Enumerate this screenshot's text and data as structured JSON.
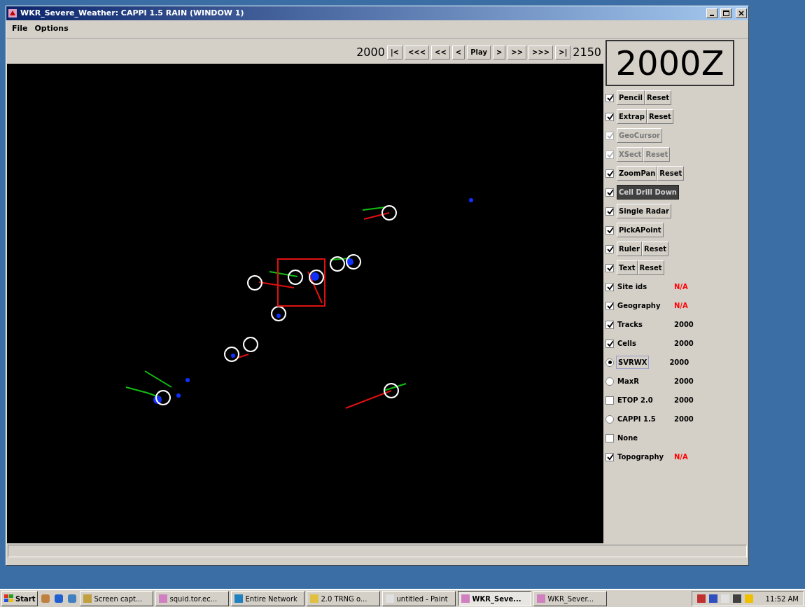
{
  "window": {
    "title": "WKR_Severe_Weather: CAPPI 1.5 RAIN (WINDOW 1)"
  },
  "menu": [
    "File",
    "Options"
  ],
  "time_controls": {
    "start": "2000",
    "end": "2150",
    "current": "2000Z",
    "buttons": [
      "|<",
      "<<<",
      "<<",
      "<",
      "Play",
      ">",
      ">>",
      ">>>",
      ">|"
    ]
  },
  "tools": [
    {
      "checked": true,
      "disabled": false,
      "selected": false,
      "buttons": [
        "Pencil",
        "Reset"
      ]
    },
    {
      "checked": true,
      "disabled": false,
      "selected": false,
      "buttons": [
        "Extrap",
        "Reset"
      ]
    },
    {
      "checked": true,
      "disabled": true,
      "selected": false,
      "buttons": [
        "GeoCursor"
      ]
    },
    {
      "checked": true,
      "disabled": true,
      "selected": false,
      "buttons": [
        "XSect",
        "Reset"
      ]
    },
    {
      "checked": true,
      "disabled": false,
      "selected": false,
      "buttons": [
        "ZoomPan",
        "Reset"
      ]
    },
    {
      "checked": true,
      "disabled": false,
      "selected": true,
      "buttons": [
        "Cell Drill Down"
      ]
    },
    {
      "checked": true,
      "disabled": false,
      "selected": false,
      "buttons": [
        "Single Radar"
      ]
    },
    {
      "checked": true,
      "disabled": false,
      "selected": false,
      "buttons": [
        "PickAPoint"
      ]
    },
    {
      "checked": true,
      "disabled": false,
      "selected": false,
      "buttons": [
        "Ruler",
        "Reset"
      ]
    },
    {
      "checked": true,
      "disabled": false,
      "selected": false,
      "buttons": [
        "Text",
        "Reset"
      ]
    }
  ],
  "layers": [
    {
      "kind": "checkbox",
      "label": "Site ids",
      "checked": true,
      "value": "N/A",
      "color": "#ff0000"
    },
    {
      "kind": "checkbox",
      "label": "Geography",
      "checked": true,
      "value": "N/A",
      "color": "#ff0000"
    },
    {
      "kind": "checkbox",
      "label": "Tracks",
      "checked": true,
      "value": "2000",
      "color": "#000000"
    },
    {
      "kind": "checkbox",
      "label": "Cells",
      "checked": true,
      "value": "2000",
      "color": "#000000"
    },
    {
      "kind": "radio",
      "label": "SVRWX",
      "selected": true,
      "value": "2000",
      "color": "#000000"
    },
    {
      "kind": "radio",
      "label": "MaxR",
      "selected": false,
      "value": "2000",
      "color": "#000000"
    },
    {
      "kind": "checkbox",
      "label": "ETOP 2.0",
      "checked": false,
      "value": "2000",
      "color": "#000000"
    },
    {
      "kind": "radio",
      "label": "CAPPI 1.5",
      "selected": false,
      "value": "2000",
      "color": "#000000"
    },
    {
      "kind": "checkbox",
      "label": "None",
      "checked": false
    },
    {
      "kind": "checkbox",
      "label": "Topography",
      "checked": true,
      "value": "N/A",
      "color": "#ff0000"
    }
  ],
  "taskbar": {
    "start": "Start",
    "tasks": [
      {
        "label": "Screen capt...",
        "selected": false
      },
      {
        "label": "squid.tor.ec...",
        "selected": false
      },
      {
        "label": "Entire Network",
        "selected": false
      },
      {
        "label": "2.0 TRNG o...",
        "selected": false
      },
      {
        "label": "untitled - Paint",
        "selected": false
      },
      {
        "label": "WKR_Seve...",
        "selected": true
      },
      {
        "label": "WKR_Sever...",
        "selected": false
      }
    ],
    "clock": "11:52 AM"
  }
}
